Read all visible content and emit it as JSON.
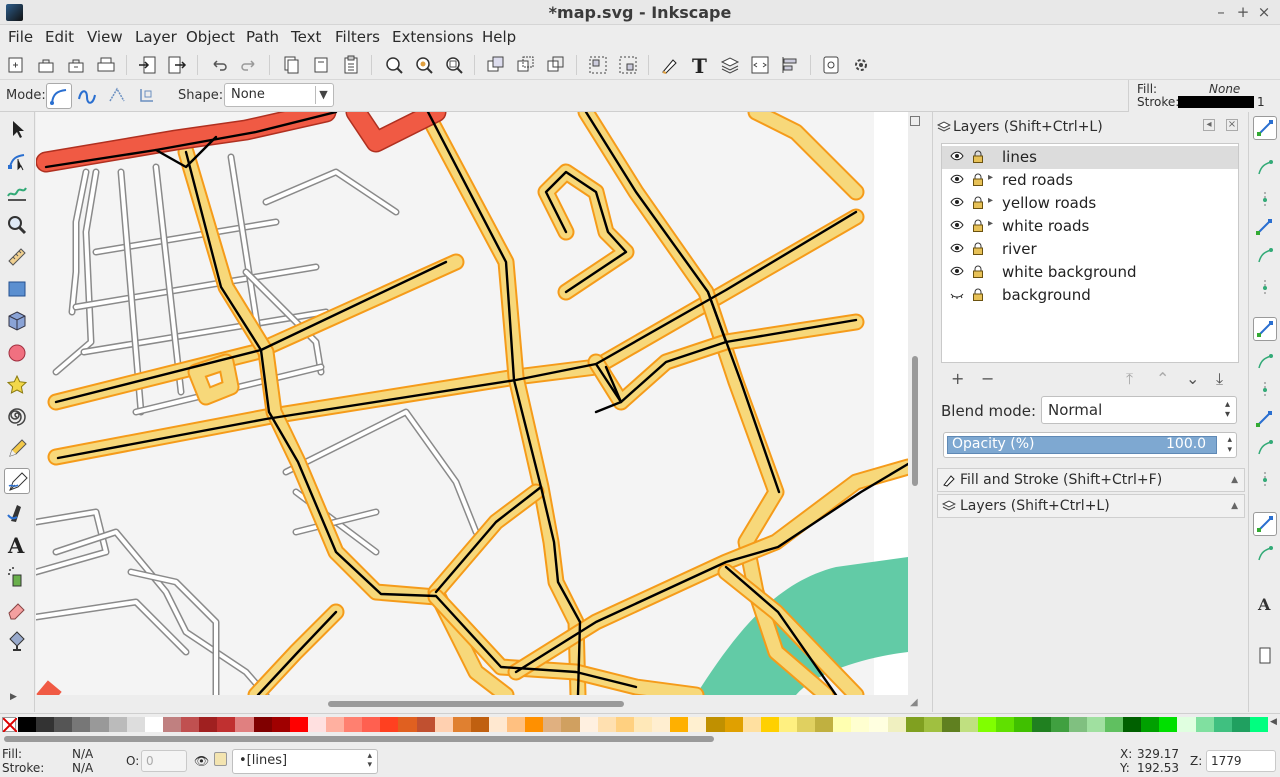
{
  "window": {
    "title": "*map.svg - Inkscape",
    "minimize": "–",
    "maximize": "+",
    "close": "×"
  },
  "menu": [
    "File",
    "Edit",
    "View",
    "Layer",
    "Object",
    "Path",
    "Text",
    "Filters",
    "Extensions",
    "Help"
  ],
  "controls": {
    "mode_label": "Mode:",
    "shape_label": "Shape:",
    "shape_value": "None",
    "fill_label": "Fill:",
    "fill_value": "None",
    "stroke_label": "Stroke:",
    "stroke_width": "1"
  },
  "layers_panel": {
    "title": "Layers (Shift+Ctrl+L)",
    "layers": [
      {
        "name": "lines",
        "selected": true,
        "expander": false,
        "visible": true
      },
      {
        "name": "red roads",
        "selected": false,
        "expander": true,
        "visible": true
      },
      {
        "name": "yellow roads",
        "selected": false,
        "expander": true,
        "visible": true
      },
      {
        "name": "white roads",
        "selected": false,
        "expander": true,
        "visible": true
      },
      {
        "name": "river",
        "selected": false,
        "expander": false,
        "visible": true
      },
      {
        "name": "white background",
        "selected": false,
        "expander": false,
        "visible": true
      },
      {
        "name": "background",
        "selected": false,
        "expander": false,
        "visible": false
      }
    ],
    "add_symbol": "+",
    "remove_symbol": "−",
    "blend_label": "Blend mode:",
    "blend_value": "Normal",
    "opacity_label": "Opacity (%)",
    "opacity_value": "100.0",
    "opacity_fraction": 1.0
  },
  "collapsed_panels": [
    "Fill and Stroke (Shift+Ctrl+F)",
    "Layers (Shift+Ctrl+L)"
  ],
  "status": {
    "fill_label": "Fill:",
    "fill_value": "N/A",
    "stroke_label": "Stroke:",
    "stroke_value": "N/A",
    "opacity_label": "O:",
    "opacity_value": "0",
    "current_layer": "•[lines]",
    "x_label": "X:",
    "x_value": "329.17",
    "y_label": "Y:",
    "y_value": "192.53",
    "zoom_label": "Z:",
    "zoom_value": "1779"
  },
  "colors": {
    "red_road": "#f05a44",
    "yellow_road": "#f7d87a",
    "road_outline": "#f59b1a",
    "river": "#62cba6",
    "white_road_outline": "#8a8a8a",
    "selection": "#7ea8d1"
  },
  "palette": [
    "#000000",
    "#333333",
    "#555555",
    "#777777",
    "#999999",
    "#bbbbbb",
    "#dddddd",
    "#ffffff",
    "#c08080",
    "#c05050",
    "#a02020",
    "#c03030",
    "#e08080",
    "#800000",
    "#a00000",
    "#ff0000",
    "#ffe0e0",
    "#ffb0a0",
    "#ff8070",
    "#ff6050",
    "#ff4020",
    "#e06020",
    "#c05030",
    "#ffd0b0",
    "#e08030",
    "#c06010",
    "#ffe8d0",
    "#ffc080",
    "#ff9000",
    "#e0b080",
    "#d0a060",
    "#fff0e0",
    "#ffe0b0",
    "#ffd080",
    "#ffe8b8",
    "#ffeed0",
    "#ffb000",
    "#fff0d0",
    "#c09000",
    "#e0a000",
    "#ffe0a0",
    "#ffd000",
    "#fff080",
    "#e0d060",
    "#c0b040",
    "#ffffb0",
    "#ffffd0",
    "#ffffe0",
    "#f0f0c0",
    "#80a020",
    "#a0c040",
    "#608020",
    "#c0e080",
    "#80ff00",
    "#60e000",
    "#40c000",
    "#208020",
    "#40a040",
    "#80c080",
    "#a0e0a0",
    "#60c060",
    "#006000",
    "#00a000",
    "#00e000",
    "#e0ffe0",
    "#80e0a0",
    "#40c080",
    "#20a060",
    "#00ff80"
  ],
  "icons": {
    "tools": [
      "selector-tool",
      "node-tool",
      "tweak-tool",
      "zoom-tool",
      "measure-tool",
      "rect-tool",
      "3dbox-tool",
      "ellipse-tool",
      "star-tool",
      "spiral-tool",
      "pencil-tool",
      "pen-tool",
      "calligraphy-tool",
      "text-tool",
      "spray-tool",
      "eraser-tool",
      "bucket-tool"
    ]
  }
}
